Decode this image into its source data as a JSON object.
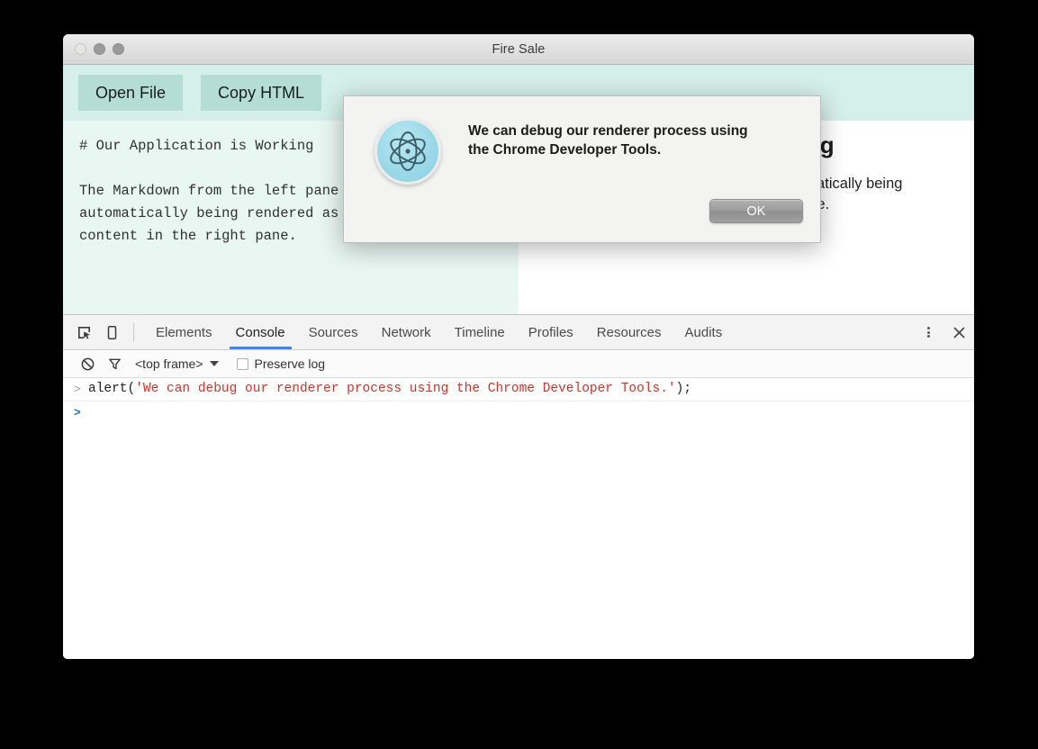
{
  "window": {
    "title": "Fire Sale",
    "traffic_lights": [
      "close",
      "minimize",
      "maximize"
    ]
  },
  "app": {
    "toolbar": {
      "buttons": [
        {
          "label": "Open File",
          "name": "open-file-button"
        },
        {
          "label": "Copy HTML",
          "name": "copy-html-button"
        }
      ]
    },
    "editor": {
      "content": "# Our Application is Working\n\nThe Markdown from the left pane is\nautomatically being rendered as HTML\ncontent in the right pane."
    },
    "preview": {
      "heading": "Our Application is Working",
      "paragraph": "The Markdown from the left pane is automatically being rendered as HTML content in the right pane."
    }
  },
  "devtools": {
    "icons": {
      "inspect": "inspect-element-icon",
      "device": "device-toolbar-icon",
      "menu": "kebab-menu-icon",
      "close": "close-icon"
    },
    "tabs": [
      {
        "label": "Elements",
        "active": false
      },
      {
        "label": "Console",
        "active": true
      },
      {
        "label": "Sources",
        "active": false
      },
      {
        "label": "Network",
        "active": false
      },
      {
        "label": "Timeline",
        "active": false
      },
      {
        "label": "Profiles",
        "active": false
      },
      {
        "label": "Resources",
        "active": false
      },
      {
        "label": "Audits",
        "active": false
      }
    ],
    "filterbar": {
      "clear_icon": "clear-console-icon",
      "filter_icon": "filter-funnel-icon",
      "frame_selected": "<top frame>",
      "preserve_log_label": "Preserve log",
      "preserve_log_checked": false
    },
    "console": {
      "entry_prompt": ">",
      "entry_code_prefix": "alert(",
      "entry_code_string": "'We can debug our renderer process using the Chrome Developer Tools.'",
      "entry_code_suffix": ");",
      "input_prompt": ">",
      "input_value": ""
    }
  },
  "dialog": {
    "logo_icon": "electron-atom-logo-icon",
    "message": "We can debug our renderer process using the Chrome Developer Tools.",
    "ok_label": "OK"
  },
  "colors": {
    "accent_tab_underline": "#4285f4",
    "toolbar_bg": "#d5efe9",
    "button_bg": "#b3ddd5",
    "editor_bg": "#e9f7f3",
    "console_string": "#d93025"
  }
}
